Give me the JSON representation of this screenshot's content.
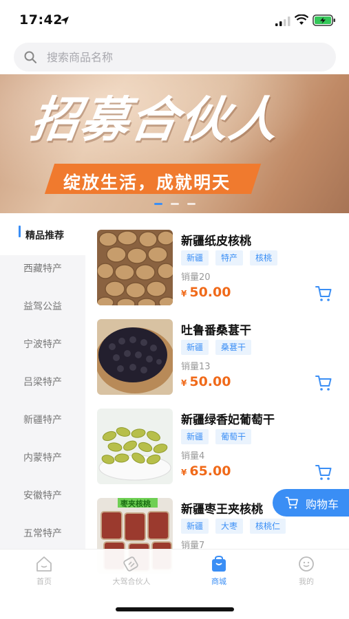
{
  "status": {
    "time": "17:42"
  },
  "search": {
    "placeholder": "搜索商品名称"
  },
  "banner": {
    "title": "招募合伙人",
    "subtitle": "绽放生活，成就明天",
    "slide_count": 3,
    "active_slide": 0
  },
  "sidebar": {
    "items": [
      {
        "label": "精品推荐",
        "active": true
      },
      {
        "label": "西藏特产"
      },
      {
        "label": "益驾公益"
      },
      {
        "label": "宁波特产"
      },
      {
        "label": "吕梁特产"
      },
      {
        "label": "新疆特产"
      },
      {
        "label": "内蒙特产"
      },
      {
        "label": "安徽特产"
      },
      {
        "label": "五常特产"
      }
    ]
  },
  "products": [
    {
      "name": "新疆纸皮核桃",
      "tags": [
        "新疆",
        "特产",
        "核桃"
      ],
      "sales": "销量20",
      "currency": "¥",
      "price": "50.00",
      "image": "walnut"
    },
    {
      "name": "吐鲁番桑葚干",
      "tags": [
        "新疆",
        "桑葚干"
      ],
      "sales": "销量13",
      "currency": "¥",
      "price": "50.00",
      "image": "mulberry"
    },
    {
      "name": "新疆绿香妃葡萄干",
      "tags": [
        "新疆",
        "葡萄干"
      ],
      "sales": "销量4",
      "currency": "¥",
      "price": "65.00",
      "image": "raisin"
    },
    {
      "name": "新疆枣王夹核桃",
      "tags": [
        "新疆",
        "大枣",
        "核桃仁"
      ],
      "sales": "销量7",
      "image": "date-walnut",
      "image_label": "枣夹核桃"
    }
  ],
  "float_cart": {
    "label": "购物车"
  },
  "tab_bar": {
    "items": [
      {
        "label": "首页",
        "icon": "home-icon"
      },
      {
        "label": "大驾合伙人",
        "icon": "partner-icon"
      },
      {
        "label": "商城",
        "icon": "mall-icon",
        "active": true
      },
      {
        "label": "我的",
        "icon": "profile-icon"
      }
    ]
  },
  "colors": {
    "accent": "#3a8ef5",
    "price": "#f06a1a",
    "banner_strip": "#f07a2e"
  }
}
